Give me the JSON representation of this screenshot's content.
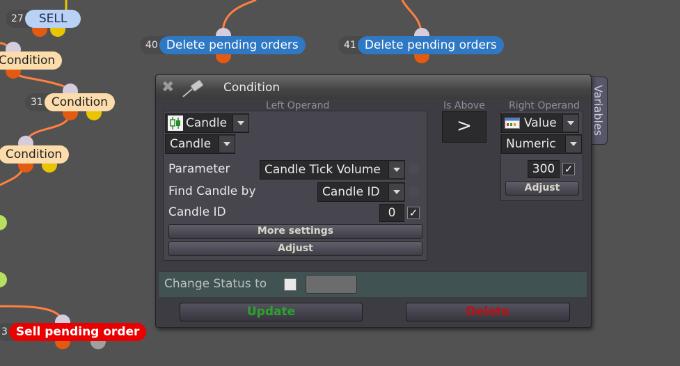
{
  "nodes": {
    "n27": {
      "num": "27",
      "label": "SELL"
    },
    "n_cond_a": {
      "label": "Condition"
    },
    "n31": {
      "num": "31",
      "label": "Condition"
    },
    "n_cond_b": {
      "label": "Condition"
    },
    "n40": {
      "num": "40",
      "label": "Delete pending orders"
    },
    "n41": {
      "num": "41",
      "label": "Delete pending orders"
    },
    "n_sell_pending": {
      "num": "3",
      "label": "Sell pending order"
    }
  },
  "dialog": {
    "title": "Condition",
    "variables_tab": "Variables",
    "left_operand": {
      "heading": "Left Operand",
      "type_combo": "Candle",
      "sub_combo": "Candle",
      "parameter_label": "Parameter",
      "parameter_value": "Candle Tick Volume",
      "find_by_label": "Find Candle by",
      "find_by_value": "Candle ID",
      "candle_id_label": "Candle ID",
      "candle_id_value": "0",
      "candle_id_checked": "✓",
      "more_settings": "More settings",
      "adjust": "Adjust"
    },
    "operator": {
      "heading": "Is Above",
      "symbol": ">"
    },
    "right_operand": {
      "heading": "Right Operand",
      "type_combo": "Value",
      "sub_combo": "Numeric",
      "value": "300",
      "value_checked": "✓",
      "adjust": "Adjust"
    },
    "status": {
      "label": "Change Status to",
      "color": "#6c6c6c"
    },
    "buttons": {
      "update": "Update",
      "delete": "Delete"
    }
  },
  "colors": {
    "canvas": "#525252",
    "wire": "#ff8040",
    "update_text": "#2aa52a",
    "delete_text": "#c01010"
  }
}
